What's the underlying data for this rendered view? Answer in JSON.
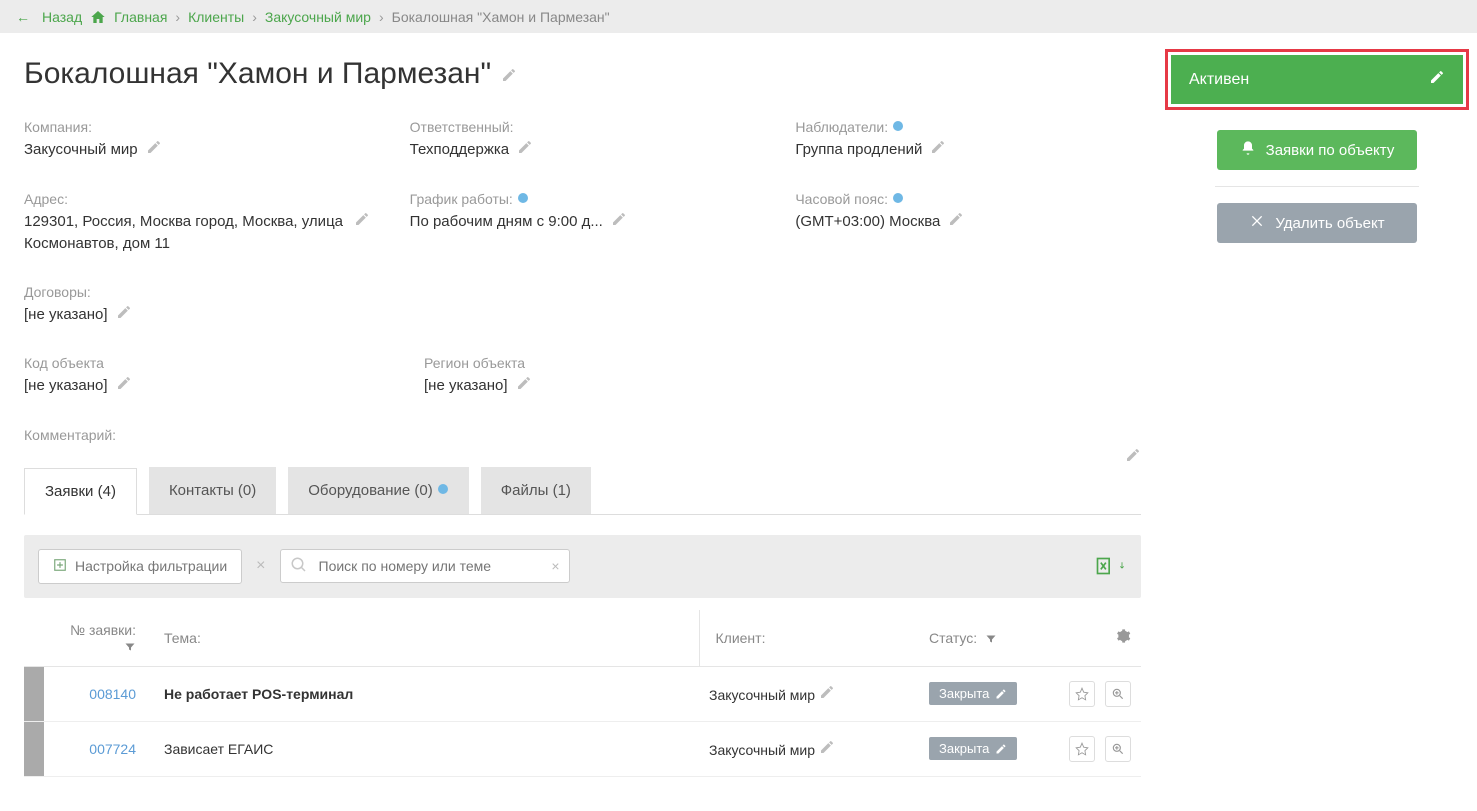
{
  "breadcrumb": {
    "back": "Назад",
    "home": "Главная",
    "clients": "Клиенты",
    "company": "Закусочный мир",
    "current": "Бокалошная \"Хамон и Пармезан\""
  },
  "title": "Бокалошная \"Хамон и Пармезан\"",
  "fields": {
    "company_label": "Компания:",
    "company_value": "Закусочный мир",
    "responsible_label": "Ответственный:",
    "responsible_value": "Техподдержка",
    "observers_label": "Наблюдатели:",
    "observers_value": "Группа продлений",
    "address_label": "Адрес:",
    "address_value": "129301, Россия, Москва город, Москва, улица Космонавтов, дом 11",
    "schedule_label": "График работы:",
    "schedule_value": "По рабочим дням с 9:00 д...",
    "timezone_label": "Часовой пояс:",
    "timezone_value": "(GMT+03:00) Москва",
    "contracts_label": "Договоры:",
    "contracts_value": "[не указано]",
    "code_label": "Код объекта",
    "code_value": "[не указано]",
    "region_label": "Регион объекта",
    "region_value": "[не указано]",
    "comment_label": "Комментарий:"
  },
  "tabs": {
    "requests": "Заявки (4)",
    "contacts": "Контакты (0)",
    "equipment": "Оборудование (0)",
    "files": "Файлы (1)"
  },
  "filters": {
    "setup": "Настройка фильтрации",
    "search_placeholder": "Поиск по номеру или теме"
  },
  "columns": {
    "id": "№ заявки:",
    "topic": "Тема:",
    "client": "Клиент:",
    "status": "Статус:"
  },
  "rows": [
    {
      "id": "008140",
      "topic": "Не работает POS-терминал",
      "bold": true,
      "client": "Закусочный мир",
      "status": "Закрыта"
    },
    {
      "id": "007724",
      "topic": "Зависает ЕГАИС",
      "bold": false,
      "client": "Закусочный мир",
      "status": "Закрыта"
    }
  ],
  "sidebar": {
    "status": "Активен",
    "requests_btn": "Заявки по объекту",
    "delete_btn": "Удалить объект"
  }
}
